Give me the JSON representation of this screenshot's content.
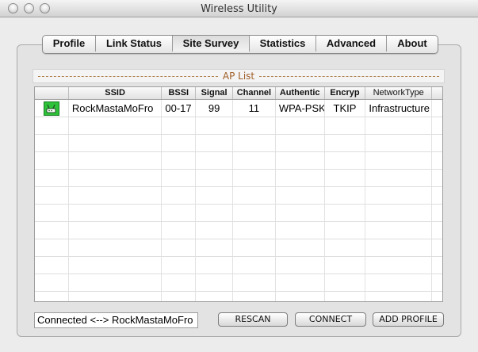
{
  "window": {
    "title": "Wireless Utility"
  },
  "tabs": [
    {
      "label": "Profile"
    },
    {
      "label": "Link Status"
    },
    {
      "label": "Site Survey"
    },
    {
      "label": "Statistics"
    },
    {
      "label": "Advanced"
    },
    {
      "label": "About"
    }
  ],
  "ap_list": {
    "title": "AP List",
    "columns": [
      "",
      "SSID",
      "BSSI",
      "Signal",
      "Channel",
      "Authentic",
      "Encryp",
      "NetworkType"
    ],
    "rows": [
      {
        "icon": "wifi-ap-icon",
        "ssid": "RockMastaMoFro",
        "bssid": "00-17",
        "signal": "99",
        "channel": "11",
        "auth": "WPA-PSK",
        "encryp": "TKIP",
        "network_type": "Infrastructure"
      }
    ],
    "empty_rows": 11
  },
  "status": {
    "text": "Connected <--> RockMastaMoFro"
  },
  "buttons": {
    "rescan": "RESCAN",
    "connect": "CONNECT",
    "add_profile": "ADD PROFILE"
  },
  "colors": {
    "ap_icon": "#2ec23a",
    "ap_title": "#a0602a",
    "dashes": "#b08250"
  }
}
